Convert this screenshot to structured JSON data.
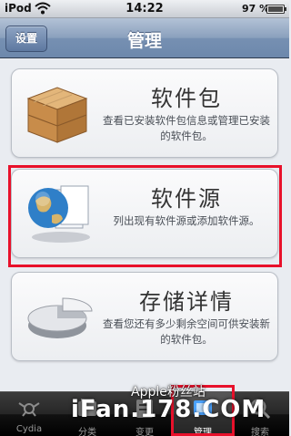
{
  "status_bar": {
    "carrier": "iPod",
    "wifi_icon": "wifi-icon",
    "time": "14:22",
    "battery_percent": "97 %",
    "battery_level": 0.97
  },
  "nav_bar": {
    "back_label": "设置",
    "title": "管理"
  },
  "cards": [
    {
      "icon": "package-box-icon",
      "title": "软件包",
      "description": "查看已安装软件包信息或管理已安装的软件包。"
    },
    {
      "icon": "globe-source-icon",
      "title": "软件源",
      "description": "列出现有软件源或添加软件源。"
    },
    {
      "icon": "storage-pie-icon",
      "title": "存储详情",
      "description": "查看您还有多少剩余空间可供安装新的软件包。"
    }
  ],
  "tab_bar": {
    "tabs": [
      {
        "label": "Cydia",
        "icon": "cydia-icon",
        "selected": false
      },
      {
        "label": "分类",
        "icon": "sections-icon",
        "selected": false
      },
      {
        "label": "变更",
        "icon": "changes-icon",
        "selected": false
      },
      {
        "label": "管理",
        "icon": "manage-icon",
        "selected": true
      },
      {
        "label": "搜索",
        "icon": "search-icon",
        "selected": false
      }
    ]
  },
  "watermark": {
    "line1": "Apple粉丝站",
    "line2": "iFan.178.COM"
  },
  "colors": {
    "highlight": "#e8112b",
    "nav_bar": "#7690b2",
    "tab_bar": "#111111"
  }
}
